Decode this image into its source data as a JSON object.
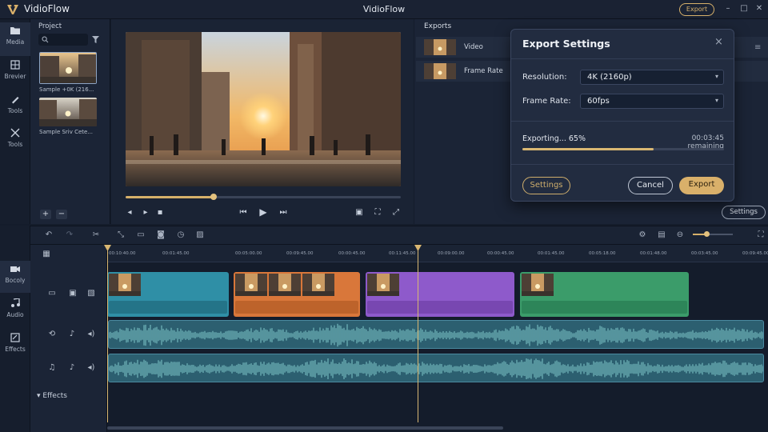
{
  "app": {
    "name": "VidioFlow",
    "window_title": "VidioFlow",
    "top_export_label": "Export"
  },
  "window_controls": {
    "minimize": "–",
    "maximize": "□",
    "close": "✕"
  },
  "sidebar": {
    "items": [
      {
        "label": "Media",
        "icon": "folder-icon"
      },
      {
        "label": "Brevier",
        "icon": "grid-icon"
      },
      {
        "label": "Tools",
        "icon": "brush-icon"
      },
      {
        "label": "Tools",
        "icon": "scissors-icon"
      }
    ]
  },
  "project": {
    "title": "Project",
    "items": [
      {
        "label": "Sample +0K (216..."
      },
      {
        "label": "Sample Sriv Cete..."
      }
    ],
    "add_label": "+",
    "remove_label": "−"
  },
  "player": {
    "progress": 0.32
  },
  "exports": {
    "title": "Exports",
    "rows": [
      {
        "label": "Video"
      },
      {
        "label": "Frame Rate"
      }
    ],
    "settings_label": "Settings"
  },
  "export_dialog": {
    "title": "Export Settings",
    "close": "×",
    "resolution_label": "Resolution:",
    "resolution_value": "4K (2160p)",
    "frame_rate_label": "Frame Rate:",
    "frame_rate_value": "60fps",
    "status_text": "Exporting... 65%",
    "remaining_text": "00:03:45 remaining",
    "progress": 0.65,
    "settings_label": "Settings",
    "cancel_label": "Cancel",
    "export_label": "Export",
    "dropdown_arrow": "▾"
  },
  "timeline": {
    "tracks": [
      {
        "label": "Bocoly"
      },
      {
        "label": "Audio"
      },
      {
        "label": "Effects"
      }
    ],
    "effects_label": "Effects",
    "timecodes": [
      "00:10:40.00",
      "00:01:45.00",
      "00:05:00.00",
      "00:09:45.00",
      "00:00:45.00",
      "00:11:45.00",
      "00:09:00.00",
      "00:00:45.00",
      "00:01:45.00",
      "00:05:18.00",
      "00:01:48.00",
      "00:03:45.00",
      "00:09:45.00"
    ],
    "clips": [
      {
        "color": "#2f8fa6"
      },
      {
        "color": "#d9773a"
      },
      {
        "color": "#8e5acb"
      },
      {
        "color": "#3b9c6a"
      }
    ],
    "audio_color": "#7fc8c9"
  },
  "colors": {
    "accent": "#d9b06a",
    "panel": "#1b2436",
    "background": "#141c2b"
  }
}
